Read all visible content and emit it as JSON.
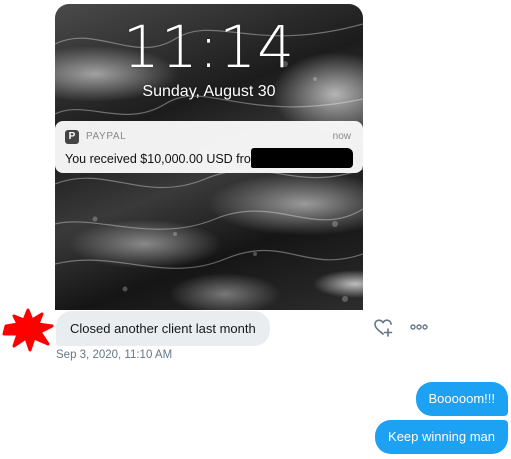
{
  "attachment": {
    "lock_time": "11:14",
    "lock_date": "Sunday, August 30",
    "notification": {
      "app_icon_glyph": "P",
      "app_name": "PAYPAL",
      "time": "now",
      "body": "You received $10,000.00 USD from"
    }
  },
  "conversation": {
    "received": {
      "text": "Closed another client last month",
      "timestamp": "Sep 3, 2020, 11:10 AM"
    },
    "sent": [
      {
        "text": "Booooom!!!"
      },
      {
        "text": "Keep winning man"
      }
    ]
  },
  "icons": {
    "react": "heart-plus-icon",
    "more": "more-horizontal-icon"
  },
  "colors": {
    "sent_bubble": "#1da1f2",
    "received_bubble": "#e9edf0",
    "timestamp": "#657786",
    "avatar_scribble": "#ff0000"
  }
}
